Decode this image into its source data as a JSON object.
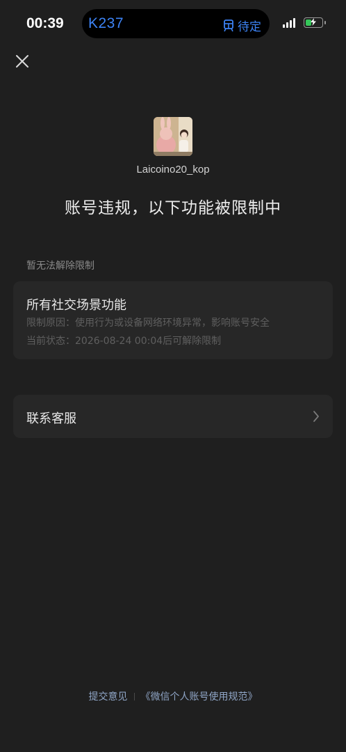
{
  "status_bar": {
    "time": "00:39",
    "island_train": "K237",
    "island_status": "待定",
    "signal_bars": 4,
    "battery_level": 0.35
  },
  "profile": {
    "username": "Laicoino20_kop"
  },
  "headline": "账号违规，以下功能被限制中",
  "restriction": {
    "section_label": "暂无法解除限制",
    "title": "所有社交场景功能",
    "reason": "限制原因：使用行为或设备网络环境异常，影响账号安全",
    "status": "当前状态：2026-08-24 00:04后可解除限制"
  },
  "contact": {
    "label": "联系客服"
  },
  "footer": {
    "feedback_link": "提交意见",
    "policy_link": "《微信个人账号使用规范》"
  },
  "colors": {
    "background": "#1f1f1f",
    "card": "#272727",
    "accent_blue": "#3d83f5",
    "link": "#8fa5c6",
    "battery_green": "#35c759"
  }
}
